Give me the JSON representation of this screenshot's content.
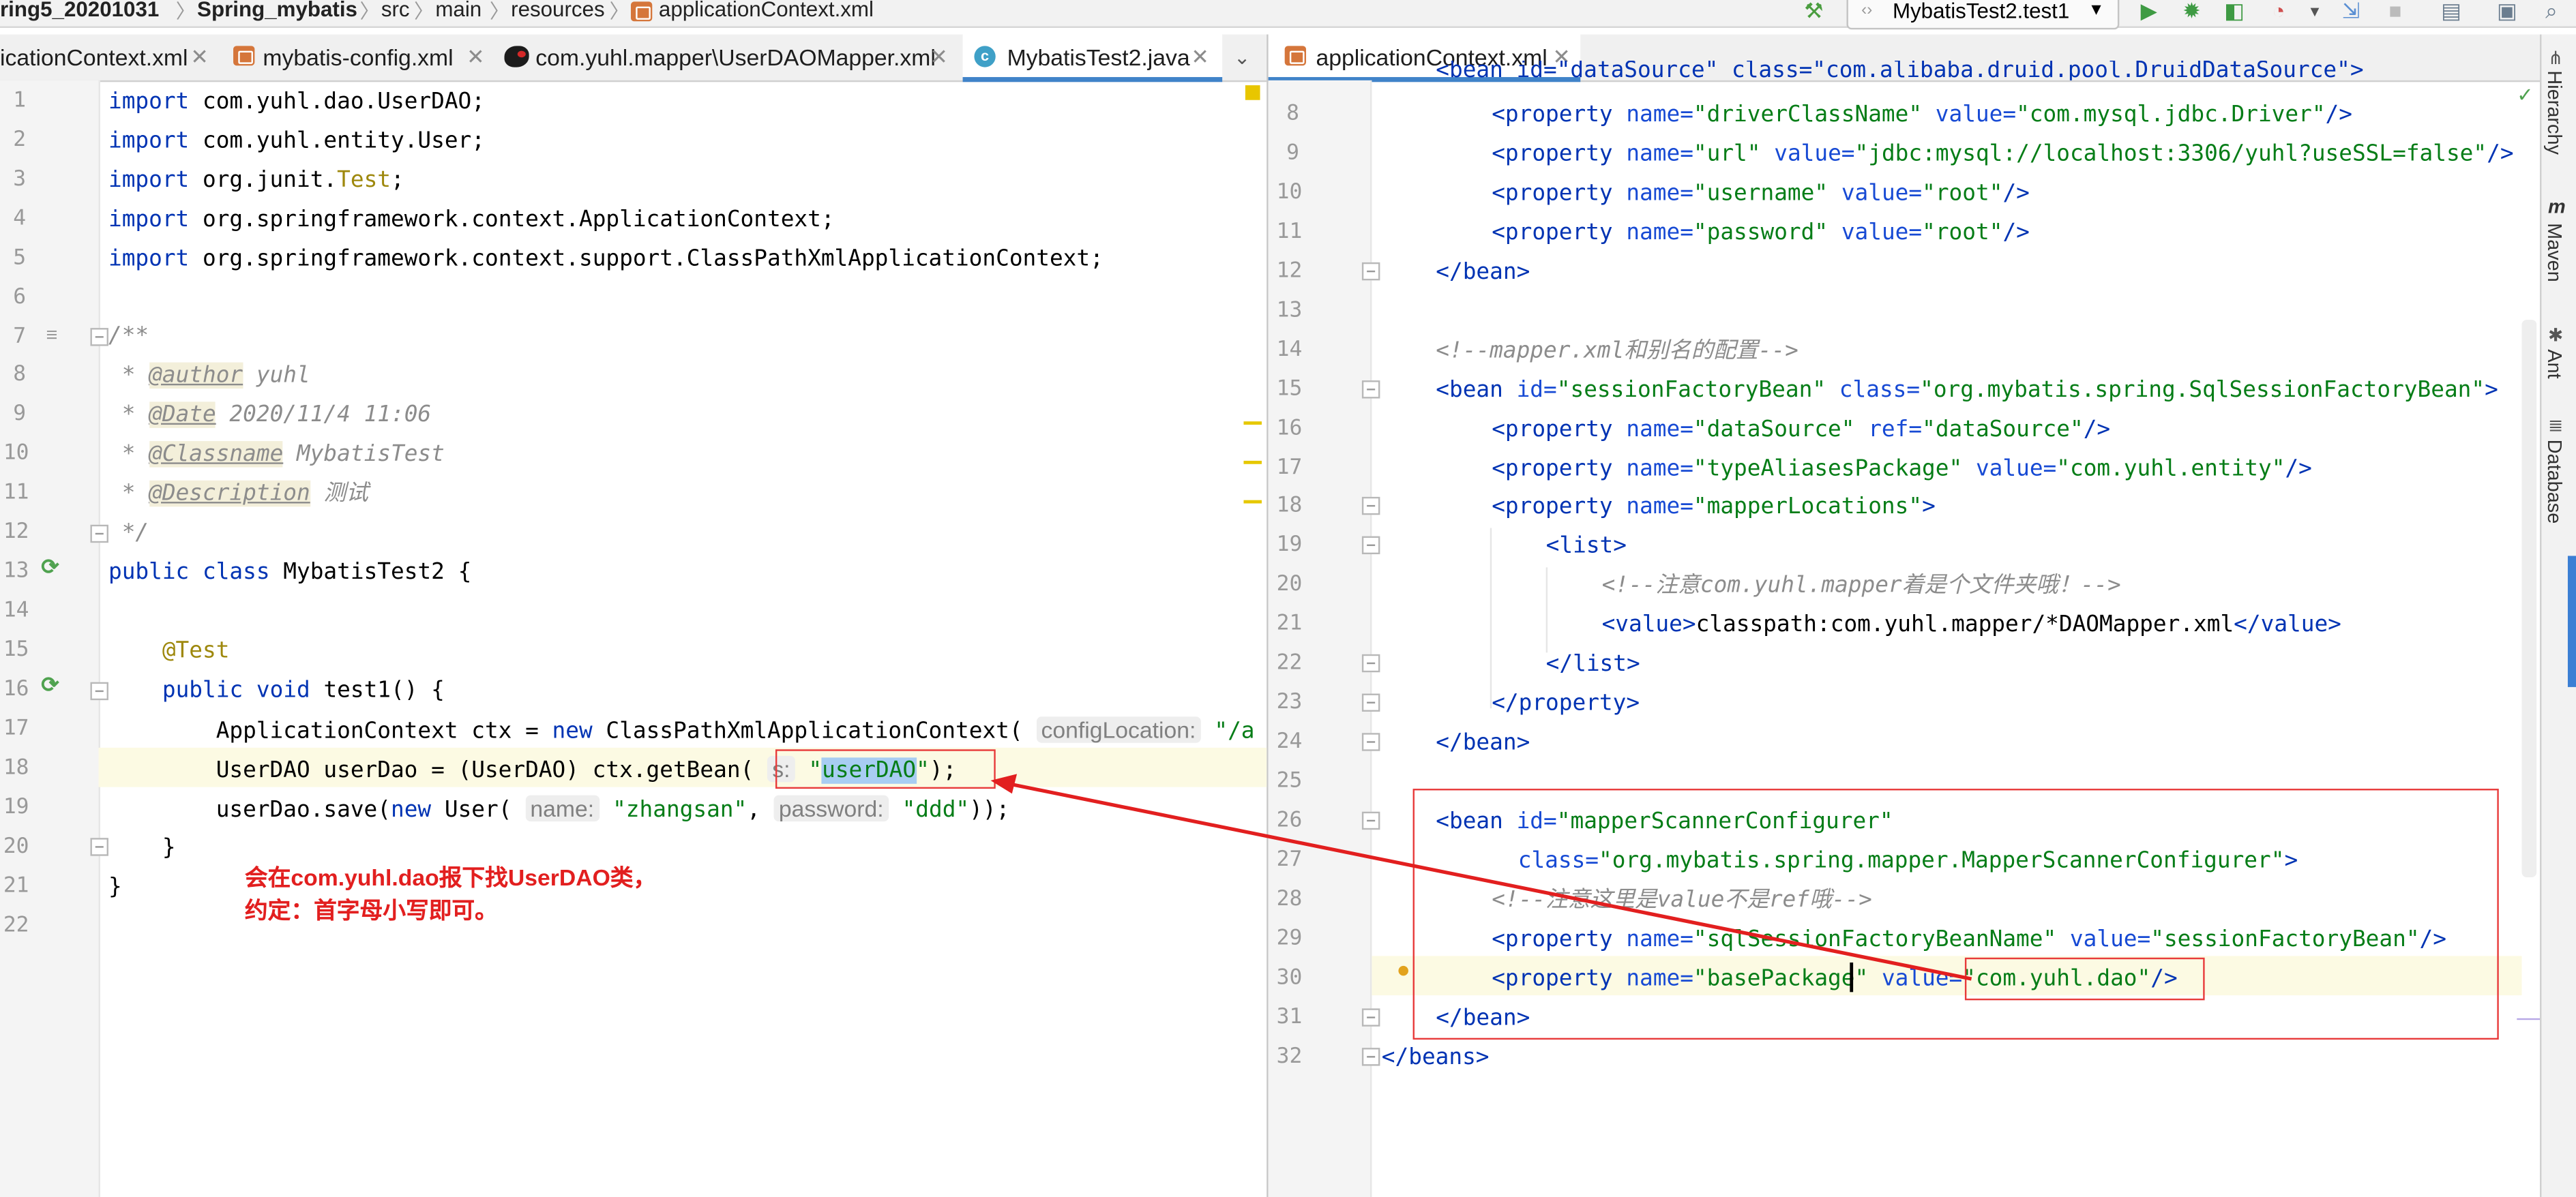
{
  "breadcrumb": {
    "project": "ring5_20201031",
    "module": "Spring_mybatis",
    "dir1": "src",
    "dir2": "main",
    "dir3": "resources",
    "file": "applicationContext.xml"
  },
  "toolbar": {
    "run_config": "MybatisTest2.test1"
  },
  "left_tabs": [
    {
      "label": "icationContext.xml"
    },
    {
      "label": "mybatis-config.xml"
    },
    {
      "label": "com.yuhl.mapper\\UserDAOMapper.xml"
    },
    {
      "label": "MybatisTest2.java"
    }
  ],
  "right_tabs": [
    {
      "label": "applicationContext.xml"
    }
  ],
  "left_editor": {
    "line_numbers": [
      "1",
      "2",
      "3",
      "4",
      "5",
      "6",
      "7",
      "8",
      "9",
      "10",
      "11",
      "12",
      "13",
      "14",
      "15",
      "16",
      "17",
      "18",
      "19",
      "20",
      "21",
      "22"
    ],
    "l1": {
      "kw": "import",
      "rest": " com.yuhl.dao.UserDAO;"
    },
    "l2": {
      "kw": "import",
      "rest": " com.yuhl.entity.User;"
    },
    "l3": {
      "kw": "import",
      "pre": " org.junit.",
      "ann": "Test",
      "post": ";"
    },
    "l4": {
      "kw": "import",
      "rest": " org.springframework.context.ApplicationContext;"
    },
    "l5": {
      "kw": "import",
      "rest": " org.springframework.context.support.ClassPathXmlApplicationContext;"
    },
    "l7": "/**",
    "l8": {
      "pre": " * ",
      "tag": "@author",
      "val": " yuhl"
    },
    "l9": {
      "pre": " * ",
      "tag": "@Date",
      "val": " 2020/11/4 11:06"
    },
    "l10": {
      "pre": " * ",
      "tag": "@Classname",
      "val": " MybatisTest"
    },
    "l11": {
      "pre": " * ",
      "tag": "@Description",
      "val": " 测试"
    },
    "l12": " */",
    "l13": {
      "kw": "public class",
      "rest": " MybatisTest2 {"
    },
    "l15": "    @Test",
    "l16": {
      "indent": "    ",
      "kw": "public void",
      "rest": " test1() {"
    },
    "l17": {
      "pre": "        ApplicationContext ctx = ",
      "kw": "new",
      "post": " ClassPathXmlApplicationContext(",
      "hint": "configLocation:",
      "str": " \"/a"
    },
    "l18": {
      "pre": "        UserDAO userDao = (UserDAO) ctx.getBean(",
      "hint": "s:",
      "q1": " \"",
      "sel": "userDAO",
      "q2": "\"",
      "post": ");"
    },
    "l19": {
      "pre": "        userDao.save(",
      "kw": "new",
      "post": " User(",
      "hint1": "name:",
      "str1": " \"zhangsan\"",
      "comma": ", ",
      "hint2": "password:",
      "str2": " \"ddd\"",
      "end": "));"
    },
    "l20": "    }",
    "l21": "}"
  },
  "annotation": {
    "line1": "会在com.yuhl.dao报下找UserDAO类，",
    "line2": "约定：首字母小写即可。"
  },
  "right_editor": {
    "line_numbers": [
      "8",
      "9",
      "10",
      "11",
      "12",
      "13",
      "14",
      "15",
      "16",
      "17",
      "18",
      "19",
      "20",
      "21",
      "22",
      "23",
      "24",
      "25",
      "26",
      "27",
      "28",
      "29",
      "30",
      "31",
      "32"
    ],
    "top_cut": "<bean id=\"dataSource\" class=\"com.alibaba.druid.pool.DruidDataSource\">",
    "props_ds": [
      {
        "name": "driverClassName",
        "value": "com.mysql.jdbc.Driver"
      },
      {
        "name": "url",
        "value": "jdbc:mysql://localhost:3306/yuhl?useSSL=false"
      },
      {
        "name": "username",
        "value": "root"
      },
      {
        "name": "password",
        "value": "root"
      }
    ],
    "c14": "<!--mapper.xml和别名的配置-->",
    "sf_id": "sessionFactoryBean",
    "sf_class": "org.mybatis.spring.SqlSessionFactoryBean",
    "props_sf": [
      {
        "name": "dataSource",
        "ref": "dataSource"
      },
      {
        "name": "typeAliasesPackage",
        "value": "com.yuhl.entity"
      }
    ],
    "ml_name": "mapperLocations",
    "c20": "<!--注意com.yuhl.mapper着是个文件夹哦！-->",
    "value21": "classpath:com.yuhl.mapper/*DAOMapper.xml",
    "msc_id": "mapperScannerConfigurer",
    "msc_class": "org.mybatis.spring.mapper.MapperScannerConfigurer",
    "c28": "<!--注意这里是value不是ref哦-->",
    "p29": {
      "name": "sqlSessionFactoryBeanName",
      "value": "sessionFactoryBean"
    },
    "p30": {
      "name": "basePackage",
      "value": "com.yuhl.dao"
    }
  },
  "side_tools": [
    "Hierarchy",
    "Maven",
    "Ant",
    "Database"
  ],
  "colors": {
    "keyword": "#0033b3",
    "string": "#067d17",
    "annotation_red": "#e21f1f",
    "tab_underline": "#4083c9"
  }
}
